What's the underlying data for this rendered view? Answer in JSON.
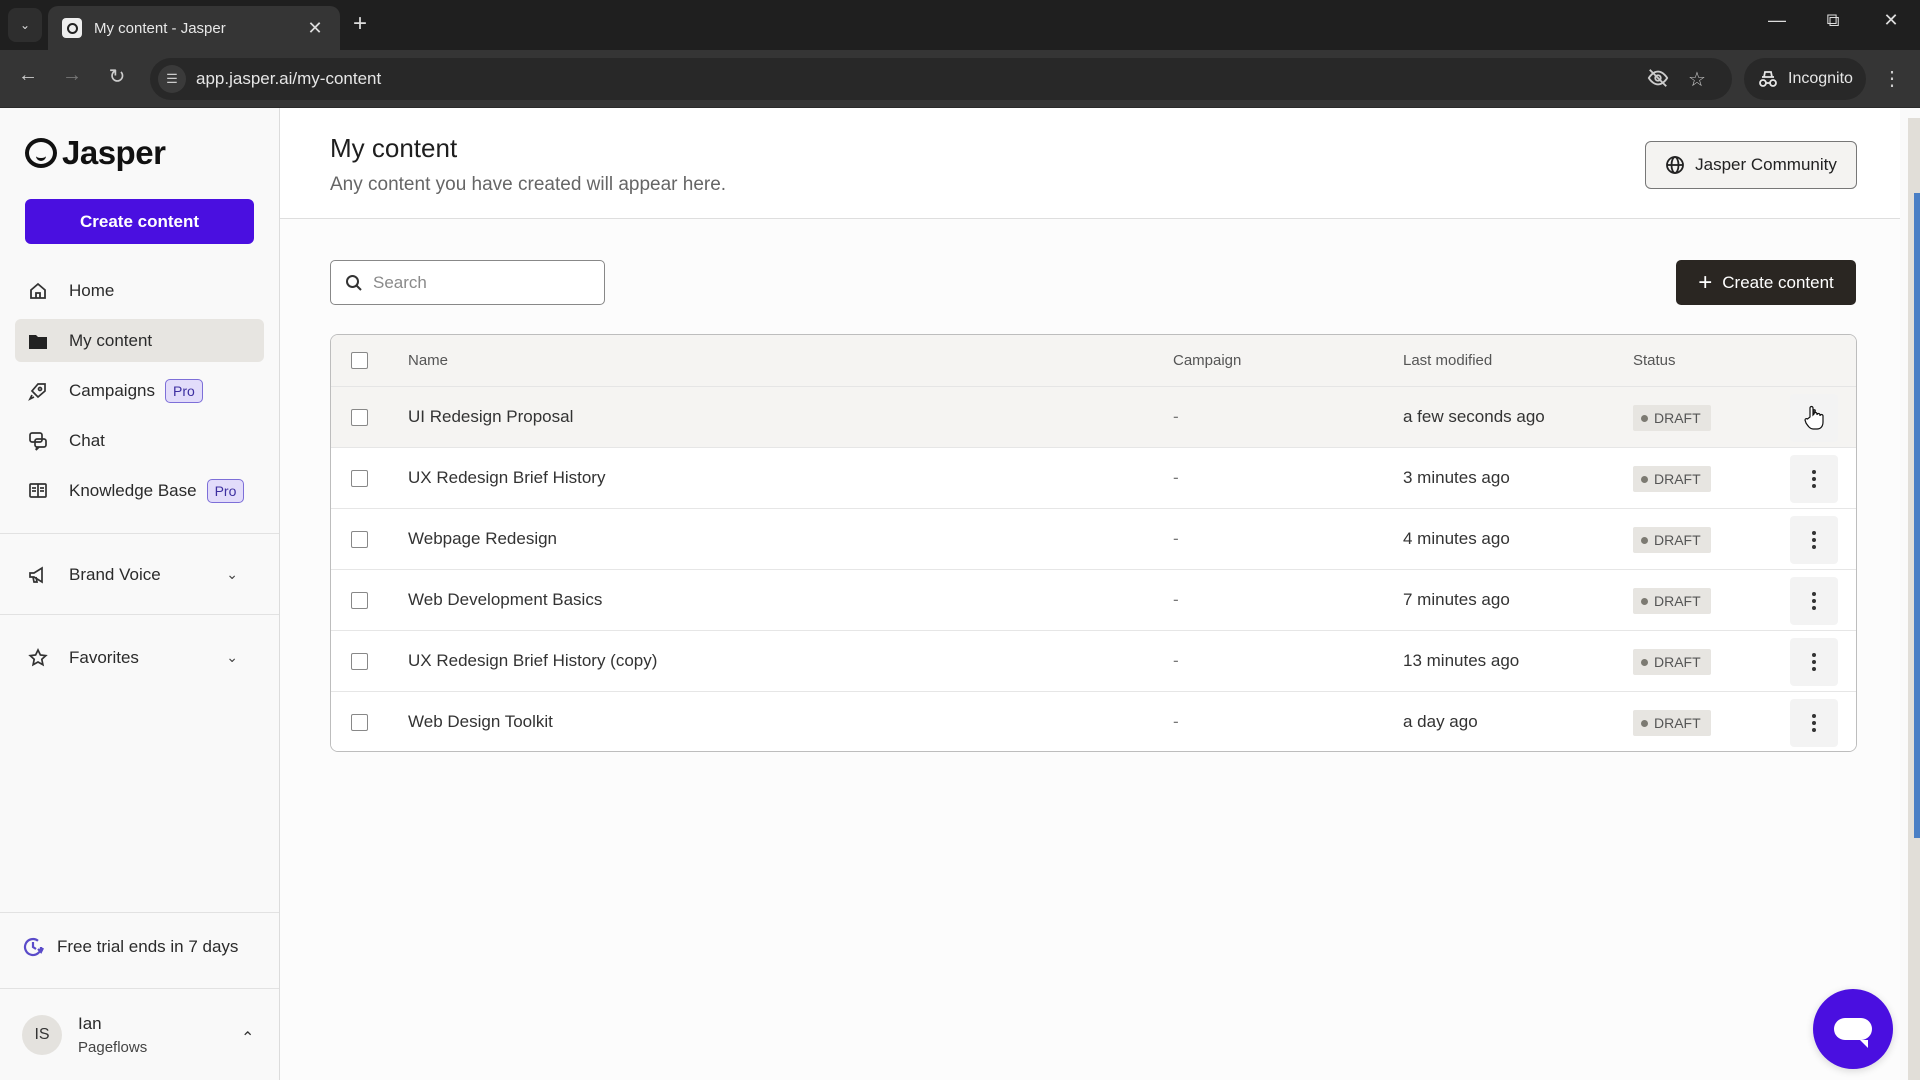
{
  "browser": {
    "tab_title": "My content - Jasper",
    "url": "app.jasper.ai/my-content",
    "incognito_label": "Incognito"
  },
  "sidebar": {
    "brand": "Jasper",
    "create_button": "Create content",
    "items": [
      {
        "label": "Home",
        "icon": "home-icon",
        "active": false
      },
      {
        "label": "My content",
        "icon": "folder-icon",
        "active": true
      },
      {
        "label": "Campaigns",
        "icon": "rocket-icon",
        "badge": "Pro"
      },
      {
        "label": "Chat",
        "icon": "chat-icon"
      },
      {
        "label": "Knowledge Base",
        "icon": "book-icon",
        "badge": "Pro"
      }
    ],
    "sections": [
      {
        "label": "Brand Voice",
        "icon": "megaphone-icon"
      },
      {
        "label": "Favorites",
        "icon": "star-icon"
      }
    ],
    "trial_text": "Free trial ends in 7 days",
    "user": {
      "initials": "IS",
      "name": "Ian",
      "org": "Pageflows"
    }
  },
  "header": {
    "title": "My content",
    "subtitle": "Any content you have created will appear here.",
    "community_button": "Jasper Community"
  },
  "toolbar": {
    "search_placeholder": "Search",
    "search_value": "",
    "create_button": "Create content"
  },
  "table": {
    "columns": [
      "Name",
      "Campaign",
      "Last modified",
      "Status"
    ],
    "rows": [
      {
        "name": "UI Redesign Proposal",
        "campaign": "-",
        "modified": "a few seconds ago",
        "status": "DRAFT"
      },
      {
        "name": "UX Redesign Brief History",
        "campaign": "-",
        "modified": "3 minutes ago",
        "status": "DRAFT"
      },
      {
        "name": "Webpage Redesign",
        "campaign": "-",
        "modified": "4 minutes ago",
        "status": "DRAFT"
      },
      {
        "name": "Web Development Basics",
        "campaign": "-",
        "modified": "7 minutes ago",
        "status": "DRAFT"
      },
      {
        "name": "UX Redesign Brief History (copy)",
        "campaign": "-",
        "modified": "13 minutes ago",
        "status": "DRAFT"
      },
      {
        "name": "Web Design Toolkit",
        "campaign": "-",
        "modified": "a day ago",
        "status": "DRAFT"
      }
    ]
  },
  "colors": {
    "brand_purple": "#4a0fe0",
    "dark_button": "#2a2622",
    "badge_bg": "#e7e5e1",
    "scroll_thumb": "#4a7fc5"
  }
}
